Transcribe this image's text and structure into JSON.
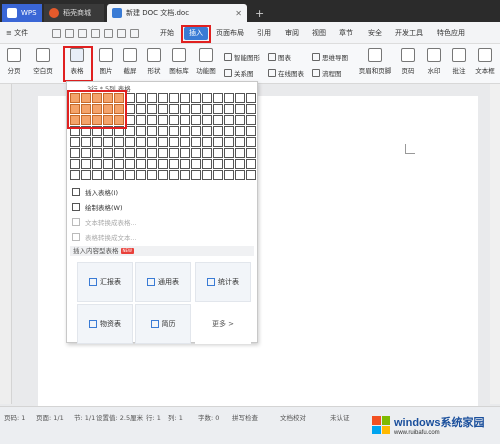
{
  "tabs": {
    "wps": "WPS",
    "mall": "稻壳商城",
    "doc": "新建 DOC 文档.doc",
    "add": "+"
  },
  "menubar": {
    "file": "≡ 文件",
    "items": [
      "开始",
      "插入",
      "页面布局",
      "引用",
      "审阅",
      "视图",
      "章节",
      "安全",
      "开发工具",
      "特色应用"
    ],
    "active": "插入"
  },
  "ribbon": {
    "page_break": "分页",
    "blank_page": "空白页",
    "table": "表格",
    "picture": "图片",
    "screenshot": "截屏",
    "shape": "形状",
    "icon_lib": "图标库",
    "func_chart": "功能图",
    "smart_graphic": "智能图形",
    "relation_graph": "关系图",
    "chart": "图表",
    "online_chart": "在线图表",
    "mind_map": "思维导图",
    "flow_chart": "流程图",
    "header_footer": "页眉和页脚",
    "page_number": "页码",
    "watermark": "水印",
    "comment": "批注",
    "textbox": "文本框"
  },
  "dropdown": {
    "header": "3行 * 5列 表格",
    "grid_rows": 8,
    "grid_cols": 17,
    "selected_rows": 3,
    "selected_cols": 5,
    "items": [
      {
        "label": "插入表格(I)",
        "disabled": false
      },
      {
        "label": "绘制表格(W)",
        "disabled": false
      },
      {
        "label": "文本转换成表格...",
        "disabled": true
      },
      {
        "label": "表格转换成文本...",
        "disabled": true
      }
    ],
    "section_title": "插入内容型表格",
    "section_badge": "NEW",
    "cards": [
      {
        "label": "汇报表",
        "icon": "report-icon"
      },
      {
        "label": "通用表",
        "icon": "grid-icon"
      },
      {
        "label": "统计表",
        "icon": "stats-icon"
      },
      {
        "label": "物资表",
        "icon": "supply-icon"
      },
      {
        "label": "简历",
        "icon": "resume-icon"
      },
      {
        "label": "更多 >",
        "icon": ""
      }
    ]
  },
  "statusbar": {
    "page_no": "页码: 1",
    "pages": "页面: 1/1",
    "section": "节: 1/1",
    "setting": "设置值: 2.5厘米",
    "row": "行: 1",
    "col": "列: 1",
    "words": "字数: 0",
    "spell": "拼写检查",
    "proof": "文档校对",
    "unsaved": "未认证"
  },
  "watermark": {
    "title": "windows系统家园",
    "url": "www.ruibafu.com"
  },
  "colors": {
    "accent": "#3a7bd5",
    "highlight_box": "#e02020",
    "selected_cell": "#f4a36a"
  }
}
